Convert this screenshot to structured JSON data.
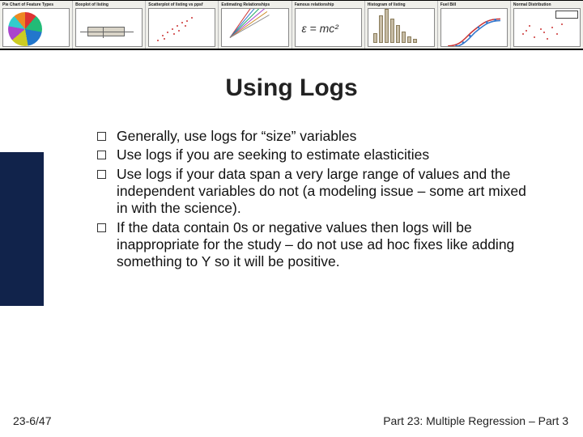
{
  "banner": {
    "thumbs": [
      {
        "title": "Pie Chart of Feature Types"
      },
      {
        "title": "Boxplot of listing"
      },
      {
        "title": "Scatterplot of listing vs ppsf"
      },
      {
        "title": "Estimating Relationships"
      },
      {
        "title": "Famous relationship"
      },
      {
        "title": "Histogram of listing"
      },
      {
        "title": "Fuel Bill"
      },
      {
        "title": "Normal Distribution"
      }
    ],
    "equation": "ε = mc²"
  },
  "slide": {
    "title": "Using Logs",
    "bullets": [
      "Generally, use logs for “size” variables",
      "Use logs if you are seeking to estimate elasticities",
      "Use logs if your data span a very large range of values and the independent variables do not (a modeling issue – some art mixed in with the science).",
      "If the data contain 0s or negative values then logs will be inappropriate for the study – do not use ad hoc fixes like adding something to Y so it will be positive."
    ],
    "page": "23-6/47",
    "part": "Part 23: Multiple Regression – Part 3"
  }
}
